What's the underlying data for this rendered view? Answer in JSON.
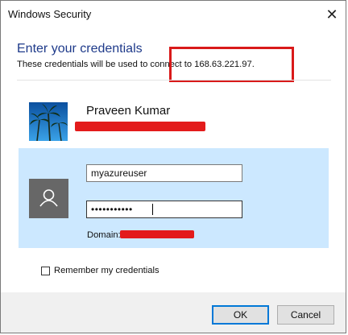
{
  "window": {
    "title": "Windows Security",
    "close_symbol": "✕"
  },
  "header": {
    "heading": "Enter your credentials",
    "description": "These credentials will be used to connect to 168.63.221.97."
  },
  "saved_user": {
    "name": "Praveen Kumar"
  },
  "credentials": {
    "username_value": "myazureuser",
    "password_value": "•••••••••••",
    "domain_label": "Domain:"
  },
  "remember": {
    "label": "Remember my credentials",
    "checked": false
  },
  "buttons": {
    "ok": "OK",
    "cancel": "Cancel"
  },
  "colors": {
    "accent": "#0078d7",
    "heading": "#1e3a8a",
    "selection": "#cce8ff",
    "highlight_box": "#d91a1a"
  }
}
